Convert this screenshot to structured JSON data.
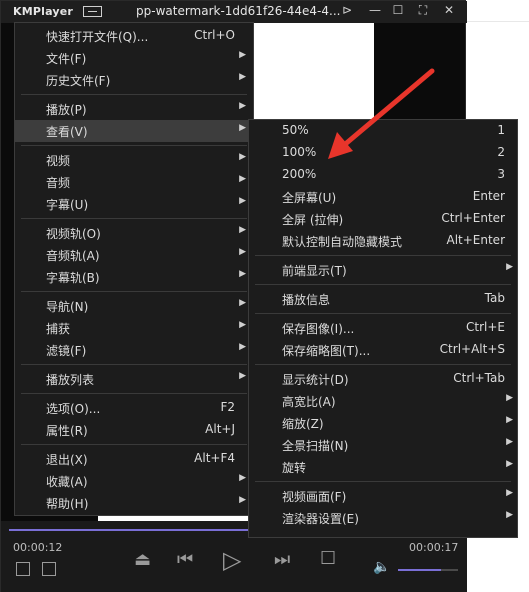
{
  "window": {
    "app_name": "KMPlayer",
    "file_title": "pp-watermark-1dd61f26-44e4-4..."
  },
  "main_menu": {
    "items": [
      {
        "label": "快速打开文件(Q)...",
        "shortcut": "Ctrl+O",
        "submenu": false
      },
      {
        "label": "文件(F)",
        "shortcut": "",
        "submenu": true
      },
      {
        "label": "历史文件(F)",
        "shortcut": "",
        "submenu": true
      },
      {
        "label": "播放(P)",
        "shortcut": "",
        "submenu": true
      },
      {
        "label": "查看(V)",
        "shortcut": "",
        "submenu": true,
        "highlighted": true
      },
      {
        "label": "视频",
        "shortcut": "",
        "submenu": true
      },
      {
        "label": "音频",
        "shortcut": "",
        "submenu": true
      },
      {
        "label": "字幕(U)",
        "shortcut": "",
        "submenu": true
      },
      {
        "label": "视频轨(O)",
        "shortcut": "",
        "submenu": true
      },
      {
        "label": "音频轨(A)",
        "shortcut": "",
        "submenu": true
      },
      {
        "label": "字幕轨(B)",
        "shortcut": "",
        "submenu": true
      },
      {
        "label": "导航(N)",
        "shortcut": "",
        "submenu": true
      },
      {
        "label": "捕获",
        "shortcut": "",
        "submenu": true
      },
      {
        "label": "滤镜(F)",
        "shortcut": "",
        "submenu": true
      },
      {
        "label": "播放列表",
        "shortcut": "",
        "submenu": true
      },
      {
        "label": "选项(O)...",
        "shortcut": "F2",
        "submenu": false
      },
      {
        "label": "属性(R)",
        "shortcut": "Alt+J",
        "submenu": false
      },
      {
        "label": "退出(X)",
        "shortcut": "Alt+F4",
        "submenu": false
      },
      {
        "label": "收藏(A)",
        "shortcut": "",
        "submenu": true
      },
      {
        "label": "帮助(H)",
        "shortcut": "",
        "submenu": true
      }
    ]
  },
  "view_submenu": {
    "items": [
      {
        "label": "50%",
        "shortcut": "1",
        "submenu": false
      },
      {
        "label": "100%",
        "shortcut": "2",
        "submenu": false
      },
      {
        "label": "200%",
        "shortcut": "3",
        "submenu": false
      },
      {
        "label": "全屏幕(U)",
        "shortcut": "Enter",
        "submenu": false
      },
      {
        "label": "全屏 (拉伸)",
        "shortcut": "Ctrl+Enter",
        "submenu": false
      },
      {
        "label": "默认控制自动隐藏模式",
        "shortcut": "Alt+Enter",
        "submenu": false
      },
      {
        "label": "前端显示(T)",
        "shortcut": "",
        "submenu": true
      },
      {
        "label": "播放信息",
        "shortcut": "Tab",
        "submenu": false
      },
      {
        "label": "保存图像(I)...",
        "shortcut": "Ctrl+E",
        "submenu": false
      },
      {
        "label": "保存缩略图(T)...",
        "shortcut": "Ctrl+Alt+S",
        "submenu": false
      },
      {
        "label": "显示统计(D)",
        "shortcut": "Ctrl+Tab",
        "submenu": false
      },
      {
        "label": "高宽比(A)",
        "shortcut": "",
        "submenu": true
      },
      {
        "label": "缩放(Z)",
        "shortcut": "",
        "submenu": true
      },
      {
        "label": "全景扫描(N)",
        "shortcut": "",
        "submenu": true
      },
      {
        "label": "旋转",
        "shortcut": "",
        "submenu": true
      },
      {
        "label": "视频画面(F)",
        "shortcut": "",
        "submenu": true
      },
      {
        "label": "渲染器设置(E)",
        "shortcut": "",
        "submenu": true
      }
    ]
  },
  "controls": {
    "time_elapsed": "00:00:12",
    "time_total": "00:00:17",
    "volume_level": 0.72
  },
  "colors": {
    "accent": "#7a6fd6",
    "annotation_arrow": "#e8352b"
  },
  "icons": [
    "minimize-icon",
    "maximize-icon",
    "fullscreen-icon",
    "close-icon",
    "pin-icon",
    "eject-icon",
    "prev-icon",
    "play-icon",
    "next-icon",
    "stop-icon",
    "speaker-icon",
    "playlist-icon",
    "download-icon",
    "submenu-arrow-icon"
  ]
}
